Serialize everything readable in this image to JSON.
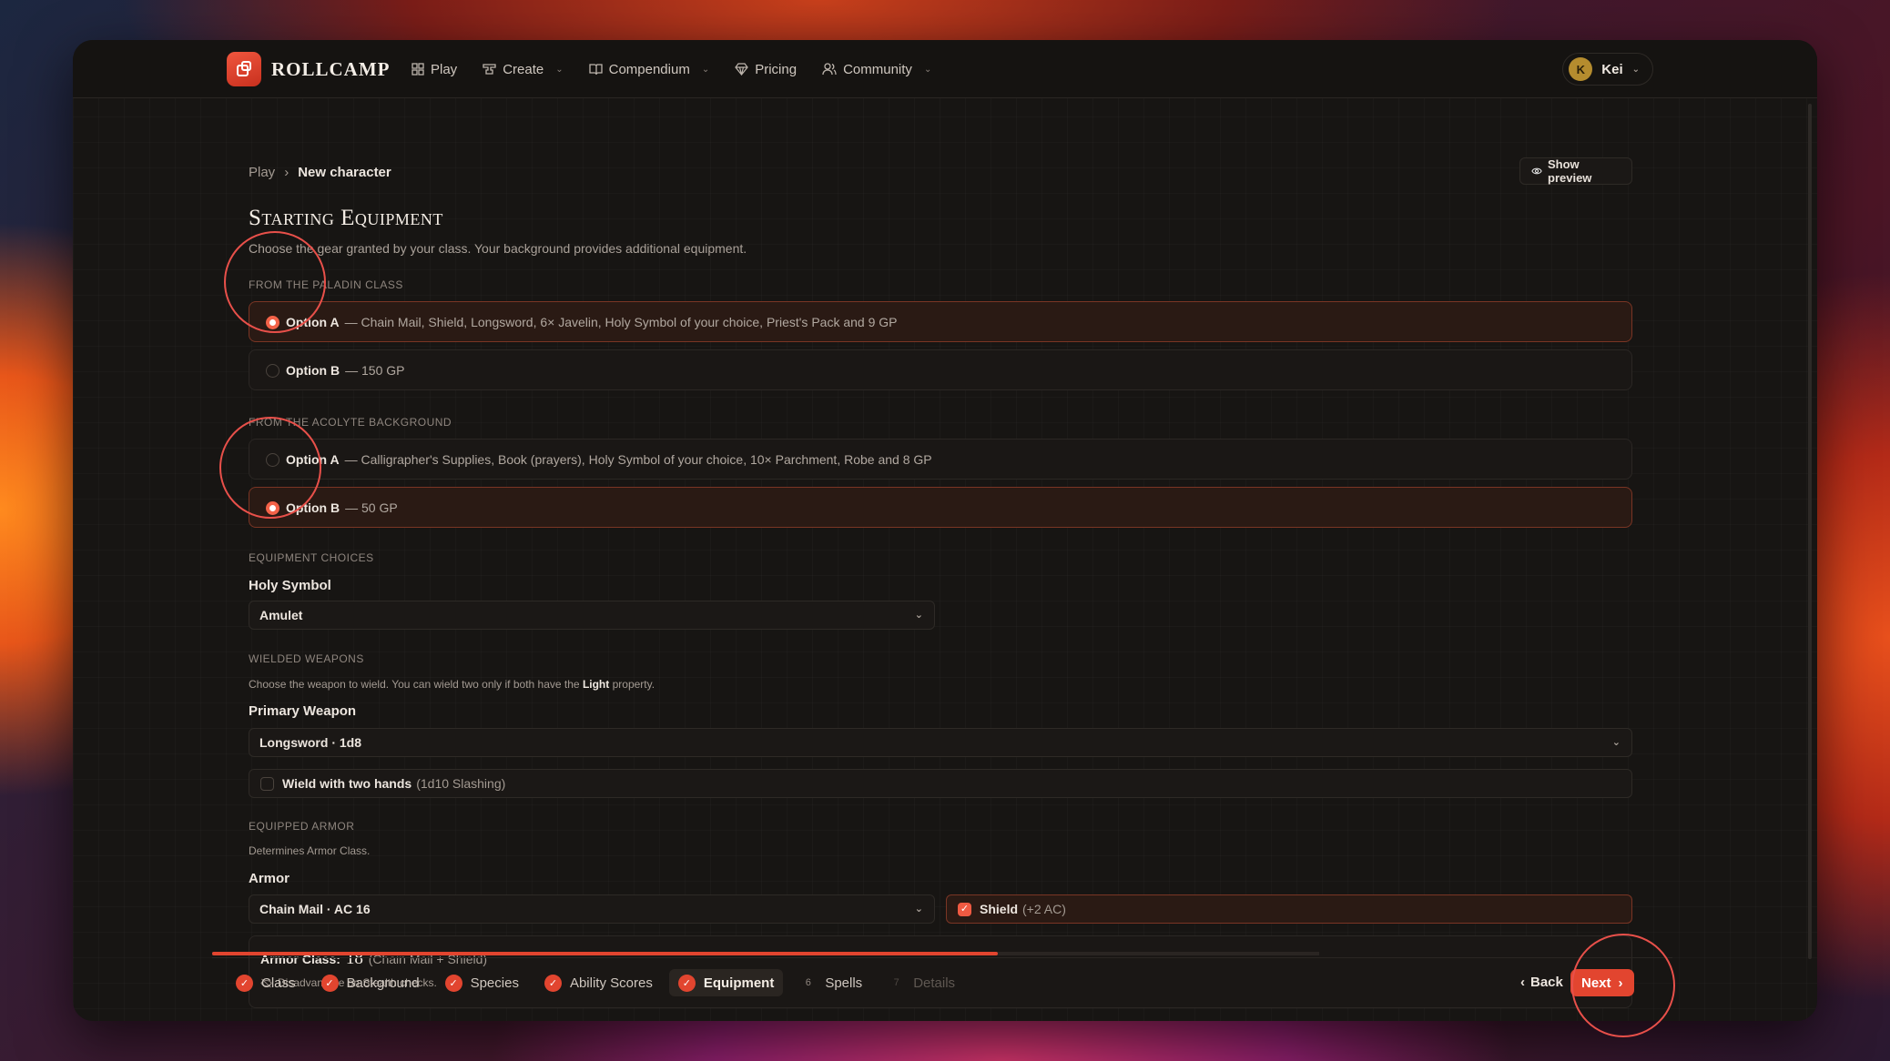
{
  "app": {
    "name": "ROLLCAMP",
    "nav": [
      {
        "label": "Play",
        "icon": "grid-icon",
        "dropdown": false
      },
      {
        "label": "Create",
        "icon": "anvil-icon",
        "dropdown": true
      },
      {
        "label": "Compendium",
        "icon": "book-icon",
        "dropdown": true
      },
      {
        "label": "Pricing",
        "icon": "gem-icon",
        "dropdown": false
      },
      {
        "label": "Community",
        "icon": "users-icon",
        "dropdown": true
      }
    ],
    "user": {
      "initial": "K",
      "name": "Kei"
    }
  },
  "breadcrumb": {
    "root": "Play",
    "separator": "›",
    "current": "New character"
  },
  "preview_button": "Show preview",
  "page": {
    "title": "Starting Equipment",
    "subtitle": "Choose the gear granted by your class. Your background provides additional equipment."
  },
  "class_section": {
    "label": "From the Paladin class",
    "options": [
      {
        "name": "Option A",
        "desc": "— Chain Mail, Shield, Longsword, 6× Javelin, Holy Symbol of your choice, Priest's Pack and 9 GP",
        "selected": true
      },
      {
        "name": "Option B",
        "desc": "— 150 GP",
        "selected": false
      }
    ]
  },
  "background_section": {
    "label": "From the Acolyte background",
    "options": [
      {
        "name": "Option A",
        "desc": "— Calligrapher's Supplies, Book (prayers), Holy Symbol of your choice, 10× Parchment, Robe and 8 GP",
        "selected": false
      },
      {
        "name": "Option B",
        "desc": "— 50 GP",
        "selected": true
      }
    ]
  },
  "equipment_choices": {
    "label": "Equipment choices",
    "holy_symbol_label": "Holy Symbol",
    "holy_symbol_value": "Amulet"
  },
  "weapons": {
    "label": "Wielded weapons",
    "hint_pre": "Choose the weapon to wield. You can wield two only if both have the",
    "hint_bold": "Light",
    "hint_post": "property.",
    "primary_label": "Primary Weapon",
    "primary_value": "Longsword · 1d8",
    "two_hands_label": "Wield with two hands",
    "two_hands_detail": "(1d10 Slashing)",
    "two_hands_checked": false
  },
  "armor": {
    "label": "Equipped armor",
    "hint": "Determines Armor Class.",
    "armor_label": "Armor",
    "armor_value": "Chain Mail · AC 16",
    "shield_label": "Shield",
    "shield_detail": "(+2 AC)",
    "shield_checked": true,
    "ac_label": "Armor Class:",
    "ac_value": "18",
    "ac_detail": "(Chain Mail + Shield)",
    "stealth_note": "Disadvantage on Stealth checks."
  },
  "progress": {
    "fraction": 0.71
  },
  "steps": [
    {
      "label": "Class",
      "state": "done"
    },
    {
      "label": "Background",
      "state": "done"
    },
    {
      "label": "Species",
      "state": "done"
    },
    {
      "label": "Ability Scores",
      "state": "done"
    },
    {
      "label": "Equipment",
      "state": "current"
    },
    {
      "label": "Spells",
      "state": "todo",
      "number": "6"
    },
    {
      "label": "Details",
      "state": "disabled",
      "number": "7"
    }
  ],
  "footer": {
    "back": "Back",
    "next": "Next"
  },
  "colors": {
    "accent": "#e2452f",
    "highlight_circle": "#e8504a"
  }
}
